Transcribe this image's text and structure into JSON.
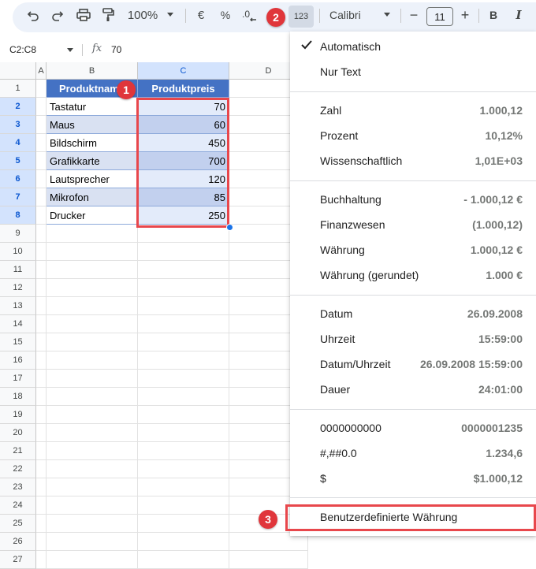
{
  "toolbar": {
    "zoom": "100%",
    "currency_symbol": "€",
    "percent_symbol": "%",
    "format_more": "123",
    "font": "Calibri",
    "font_size": "11",
    "bold": "B",
    "italic": "I",
    "minus": "−",
    "plus": "+"
  },
  "formula_bar": {
    "name_box": "C2:C8",
    "fx": "fx",
    "value": "70"
  },
  "grid": {
    "columns": [
      "A",
      "B",
      "C",
      "D"
    ],
    "rows": [
      "1",
      "2",
      "3",
      "4",
      "5",
      "6",
      "7",
      "8",
      "9",
      "10",
      "11",
      "12",
      "13",
      "14",
      "15",
      "16",
      "17",
      "18",
      "19",
      "20",
      "21",
      "22",
      "23",
      "24",
      "25",
      "26",
      "27"
    ],
    "header": {
      "b": "Produktname",
      "c": "Produktpreis"
    },
    "data": [
      {
        "name": "Tastatur",
        "price": "70"
      },
      {
        "name": "Maus",
        "price": "60"
      },
      {
        "name": "Bildschirm",
        "price": "450"
      },
      {
        "name": "Grafikkarte",
        "price": "700"
      },
      {
        "name": "Lautsprecher",
        "price": "120"
      },
      {
        "name": "Mikrofon",
        "price": "85"
      },
      {
        "name": "Drucker",
        "price": "250"
      }
    ]
  },
  "badges": [
    "1",
    "2",
    "3"
  ],
  "menu": {
    "items": [
      {
        "label": "Automatisch",
        "value": "",
        "checked": true
      },
      {
        "label": "Nur Text",
        "value": ""
      },
      {
        "label": "Zahl",
        "value": "1.000,12"
      },
      {
        "label": "Prozent",
        "value": "10,12%"
      },
      {
        "label": "Wissenschaftlich",
        "value": "1,01E+03"
      },
      {
        "label": "Buchhaltung",
        "value": "- 1.000,12 €"
      },
      {
        "label": "Finanzwesen",
        "value": "(1.000,12)"
      },
      {
        "label": "Währung",
        "value": "1.000,12 €"
      },
      {
        "label": "Währung (gerundet)",
        "value": "1.000 €"
      },
      {
        "label": "Datum",
        "value": "26.09.2008"
      },
      {
        "label": "Uhrzeit",
        "value": "15:59:00"
      },
      {
        "label": "Datum/Uhrzeit",
        "value": "26.09.2008 15:59:00"
      },
      {
        "label": "Dauer",
        "value": "24:01:00"
      },
      {
        "label": "0000000000",
        "value": "0000001235"
      },
      {
        "label": "#,##0.0",
        "value": "1.234,6"
      },
      {
        "label": "$",
        "value": "$1.000,12"
      },
      {
        "label": "Benutzerdefinierte Währung",
        "value": ""
      }
    ]
  },
  "colors": {
    "accent": "#4472c4",
    "highlight_red": "#e8474c",
    "selection": "#d3e3fd"
  }
}
